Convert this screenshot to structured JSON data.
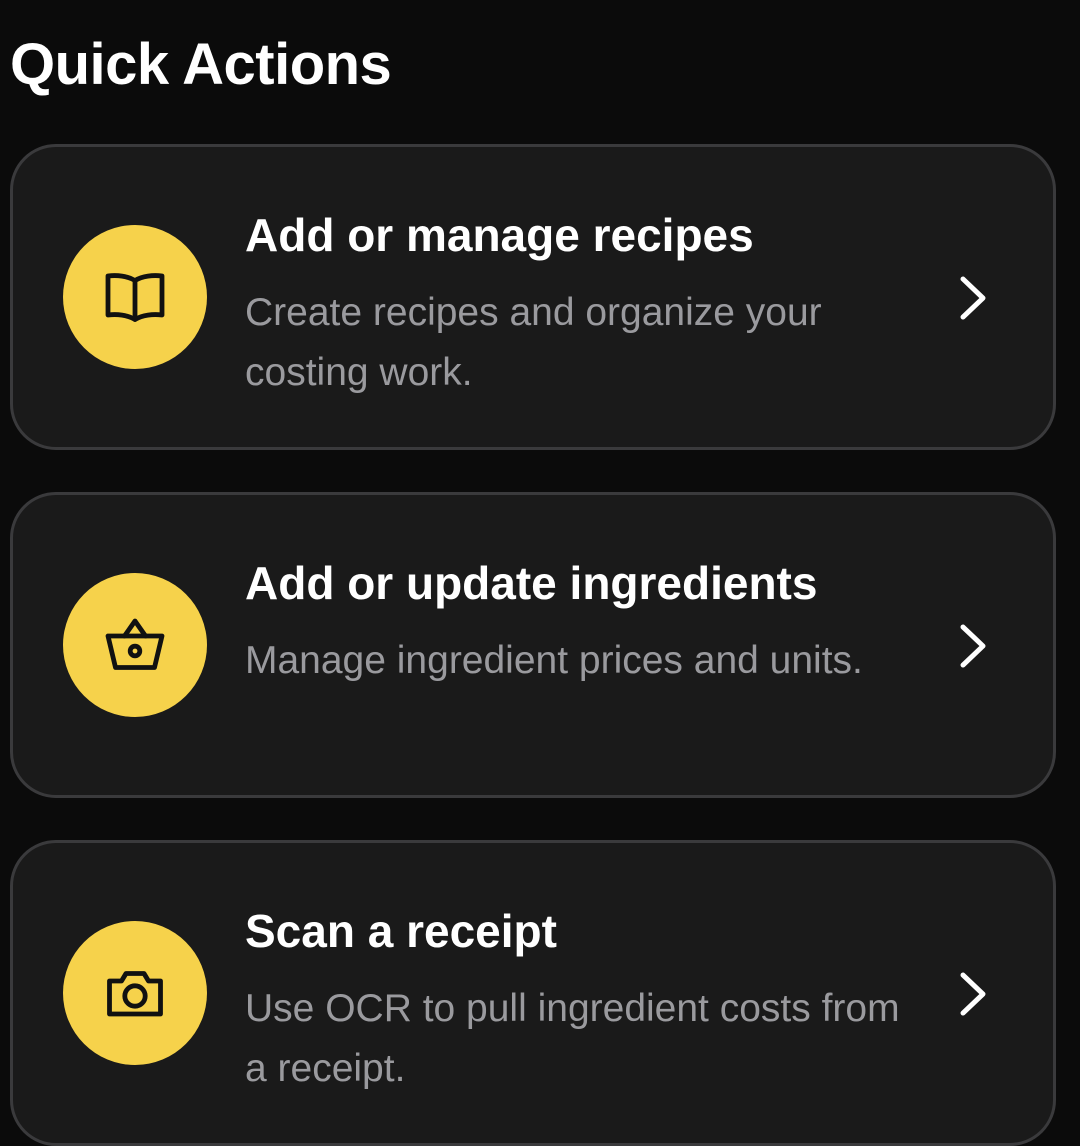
{
  "header": {
    "title": "Quick Actions"
  },
  "actions": [
    {
      "title": "Add or manage recipes",
      "description": "Create recipes and organize your costing work.",
      "icon": "open-book-icon"
    },
    {
      "title": "Add or update ingredients",
      "description": "Manage ingredient prices and units.",
      "icon": "basket-icon"
    },
    {
      "title": "Scan a receipt",
      "description": "Use OCR to pull ingredient costs from a receipt.",
      "icon": "camera-icon"
    }
  ],
  "colors": {
    "background": "#0b0b0b",
    "card": "#1a1a1a",
    "card_border": "#3a3a3c",
    "accent": "#f6d24b",
    "secondary_text": "#9a9a9e"
  }
}
